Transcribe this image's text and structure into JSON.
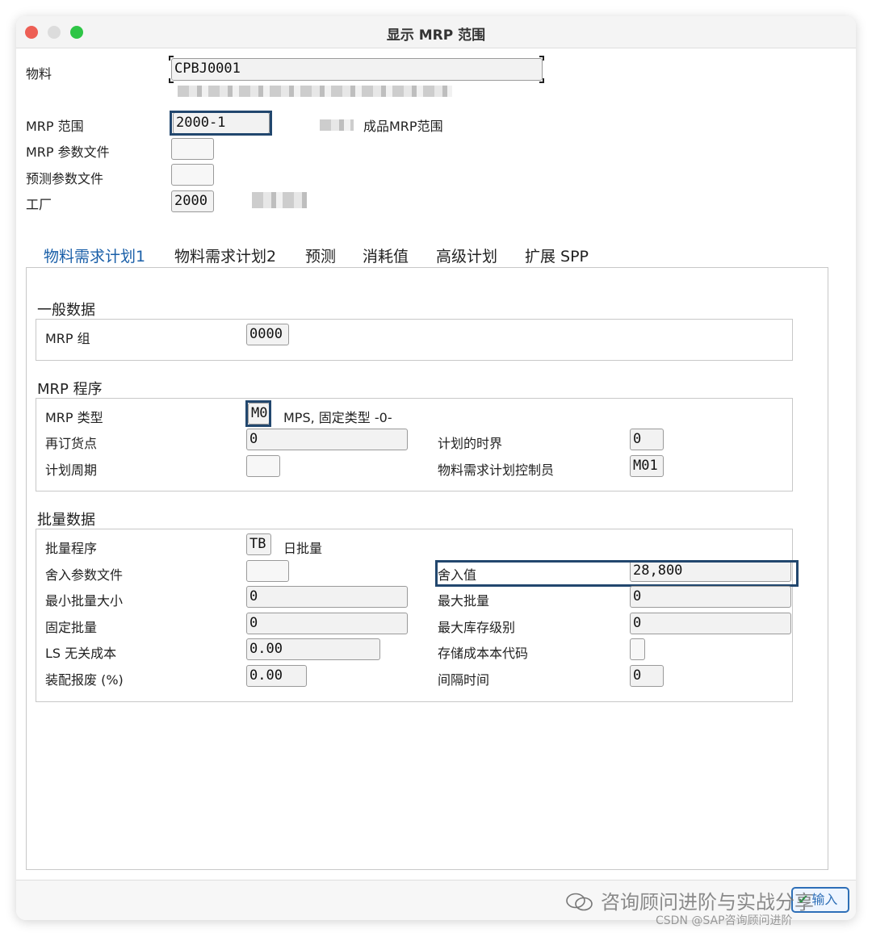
{
  "window": {
    "title": "显示 MRP 范围"
  },
  "header": {
    "material_label": "物料",
    "material_value": "CPBJ0001",
    "mrp_area_label": "MRP 范围",
    "mrp_area_value": "2000-1",
    "mrp_area_desc": "成品MRP范围",
    "mrp_profile_label": "MRP 参数文件",
    "mrp_profile_value": "",
    "forecast_profile_label": "预测参数文件",
    "forecast_profile_value": "",
    "plant_label": "工厂",
    "plant_value": "2000"
  },
  "tabs": [
    {
      "label": "物料需求计划1",
      "active": true
    },
    {
      "label": "物料需求计划2",
      "active": false
    },
    {
      "label": "预测",
      "active": false
    },
    {
      "label": "消耗值",
      "active": false
    },
    {
      "label": "高级计划",
      "active": false
    },
    {
      "label": "扩展 SPP",
      "active": false
    }
  ],
  "general": {
    "title": "一般数据",
    "mrp_group_label": "MRP 组",
    "mrp_group_value": "0000"
  },
  "mrp_procedure": {
    "title": "MRP 程序",
    "mrp_type_label": "MRP 类型",
    "mrp_type_value": "M0",
    "mrp_type_desc": "MPS, 固定类型 -0-",
    "reorder_point_label": "再订货点",
    "reorder_point_value": "0",
    "planning_fence_label": "计划的时界",
    "planning_fence_value": "0",
    "planning_cycle_label": "计划周期",
    "planning_cycle_value": "",
    "mrp_controller_label": "物料需求计划控制员",
    "mrp_controller_value": "M01"
  },
  "lot_size": {
    "title": "批量数据",
    "procedure_label": "批量程序",
    "procedure_value": "TB",
    "procedure_desc": "日批量",
    "rounding_profile_label": "舍入参数文件",
    "rounding_profile_value": "",
    "rounding_value_label": "舍入值",
    "rounding_value_value": "28,800",
    "min_lot_label": "最小批量大小",
    "min_lot_value": "0",
    "max_lot_label": "最大批量",
    "max_lot_value": "0",
    "fixed_lot_label": "固定批量",
    "fixed_lot_value": "0",
    "max_stock_label": "最大库存级别",
    "max_stock_value": "0",
    "ls_cost_label": "LS 无关成本",
    "ls_cost_value": "0.00",
    "storage_cost_label": "存储成本本代码",
    "storage_cost_value": "",
    "scrap_label": "装配报废 (%)",
    "scrap_value": "0.00",
    "takt_label": "间隔时间",
    "takt_value": "0"
  },
  "footer": {
    "enter_label": "输入"
  },
  "watermark": {
    "line1": "咨询顾问进阶与实战分享",
    "line2": "CSDN @SAP咨询顾问进阶"
  },
  "colors": {
    "highlight": "#22476e",
    "active_tab": "#1a5fa8"
  }
}
